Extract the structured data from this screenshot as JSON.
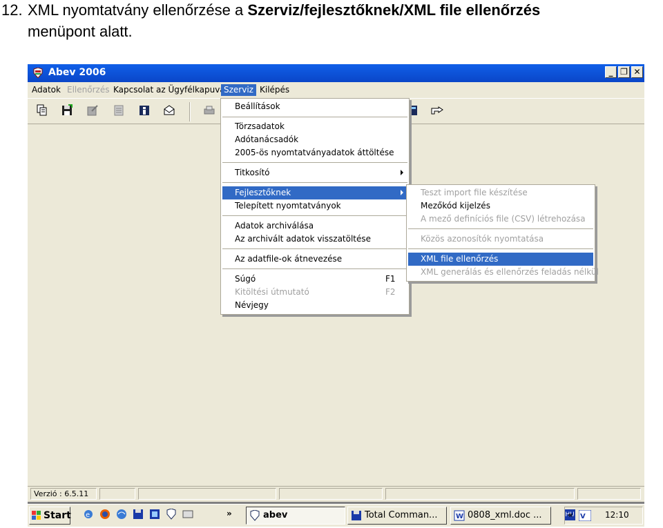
{
  "document": {
    "item_number": "12.",
    "line1_plain": "XML nyomtatvány ellenőrzése a ",
    "line1_bold": "Szerviz/fejlesztőknek/XML file ellenőrzés",
    "line2": "menüpont alatt."
  },
  "window": {
    "title": "Abev 2006",
    "buttons": {
      "minimize": "_",
      "restore": "❐",
      "close": "✕"
    }
  },
  "menubar": {
    "items": [
      {
        "label": "Adatok",
        "state": "normal"
      },
      {
        "label": "Ellenőrzés",
        "state": "disabled"
      },
      {
        "label": "Kapcsolat az Ügyfélkapuval",
        "state": "normal"
      },
      {
        "label": "Szerviz",
        "state": "active"
      },
      {
        "label": "Kilépés",
        "state": "normal"
      }
    ]
  },
  "toolbar": {
    "icons": [
      "copy-icon",
      "save-icon",
      "edit-icon",
      "document-icon",
      "info-icon",
      "mail-icon",
      "print-icon",
      "calculator-icon",
      "pointing-hand-icon"
    ]
  },
  "szerviz_menu": {
    "items": [
      {
        "label": "Beállítások"
      },
      {
        "label": "Törzsadatok"
      },
      {
        "label": "Adótanácsadók"
      },
      {
        "label": "2005-ös nyomtatványadatok áttöltése"
      },
      {
        "label": "Titkosító",
        "submenu": true
      },
      {
        "label": "Fejlesztőknek",
        "submenu": true,
        "highlighted": true
      },
      {
        "label": "Telepített nyomtatványok"
      },
      {
        "label": "Adatok archiválása"
      },
      {
        "label": "Az archivált adatok visszatöltése"
      },
      {
        "label": "Az adatfile-ok átnevezése"
      },
      {
        "label": "Súgó",
        "shortcut": "F1"
      },
      {
        "label": "Kitöltési útmutató",
        "shortcut": "F2",
        "disabled": true
      },
      {
        "label": "Névjegy"
      }
    ]
  },
  "fejlesztoknek_menu": {
    "items": [
      {
        "label": "Teszt import file készítése",
        "disabled": true
      },
      {
        "label": "Mezőkód kijelzés"
      },
      {
        "label": "A mező definíciós file (CSV) létrehozása",
        "disabled": true
      },
      {
        "label": "Közös azonosítók nyomtatása",
        "disabled": true
      },
      {
        "label": "XML file ellenőrzés",
        "highlighted": true
      },
      {
        "label": "XML generálás és ellenőrzés feladás nélkül",
        "disabled": true
      }
    ]
  },
  "statusbar": {
    "version": "Verzió : 6.5.11"
  },
  "taskbar": {
    "start_label": "Start",
    "chevron": "»",
    "tasks": [
      {
        "label": "abev",
        "active": true
      },
      {
        "label": "Total Comman..."
      },
      {
        "label": "0808_xml.doc ..."
      }
    ],
    "tray_chevron": "«",
    "tray_lang": "HU",
    "clock": "12:10"
  },
  "colors": {
    "titlebar": "#0a46c8",
    "menu_highlight": "#316ac5",
    "face": "#ece9d8",
    "workspace": "#808080"
  }
}
